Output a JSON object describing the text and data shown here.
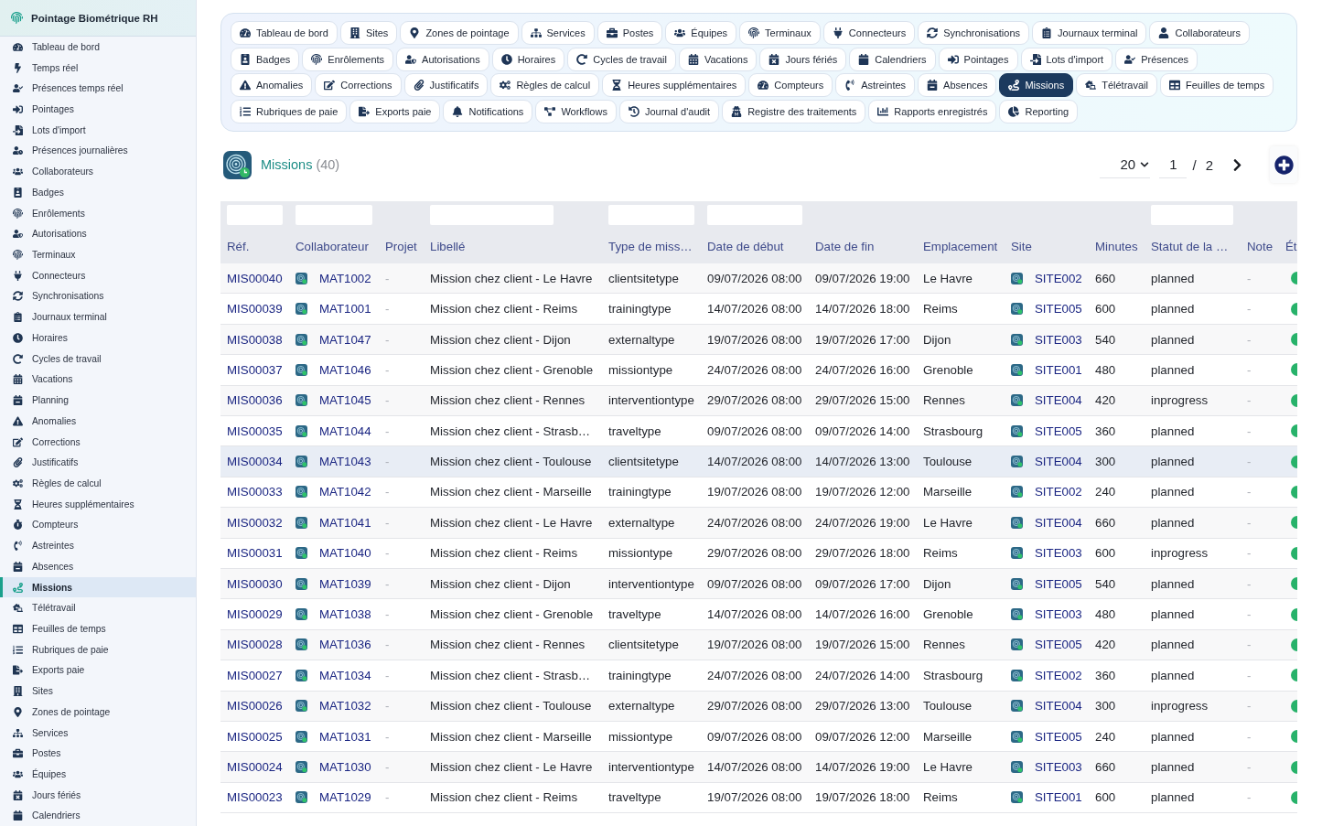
{
  "sidebar": {
    "title": "Pointage Biométrique RH",
    "items": [
      {
        "label": "Tableau de bord",
        "selected": false
      },
      {
        "label": "Temps réel",
        "selected": false
      },
      {
        "label": "Présences temps réel",
        "selected": false
      },
      {
        "label": "Pointages",
        "selected": false
      },
      {
        "label": "Lots d'import",
        "selected": false
      },
      {
        "label": "Présences journalières",
        "selected": false
      },
      {
        "label": "Collaborateurs",
        "selected": false
      },
      {
        "label": "Badges",
        "selected": false
      },
      {
        "label": "Enrôlements",
        "selected": false
      },
      {
        "label": "Autorisations",
        "selected": false
      },
      {
        "label": "Terminaux",
        "selected": false
      },
      {
        "label": "Connecteurs",
        "selected": false
      },
      {
        "label": "Synchronisations",
        "selected": false
      },
      {
        "label": "Journaux terminal",
        "selected": false
      },
      {
        "label": "Horaires",
        "selected": false
      },
      {
        "label": "Cycles de travail",
        "selected": false
      },
      {
        "label": "Vacations",
        "selected": false
      },
      {
        "label": "Planning",
        "selected": false
      },
      {
        "label": "Anomalies",
        "selected": false
      },
      {
        "label": "Corrections",
        "selected": false
      },
      {
        "label": "Justificatifs",
        "selected": false
      },
      {
        "label": "Règles de calcul",
        "selected": false
      },
      {
        "label": "Heures supplémentaires",
        "selected": false
      },
      {
        "label": "Compteurs",
        "selected": false
      },
      {
        "label": "Astreintes",
        "selected": false
      },
      {
        "label": "Absences",
        "selected": false
      },
      {
        "label": "Missions",
        "selected": true
      },
      {
        "label": "Télétravail",
        "selected": false
      },
      {
        "label": "Feuilles de temps",
        "selected": false
      },
      {
        "label": "Rubriques de paie",
        "selected": false
      },
      {
        "label": "Exports paie",
        "selected": false
      },
      {
        "label": "Sites",
        "selected": false
      },
      {
        "label": "Zones de pointage",
        "selected": false
      },
      {
        "label": "Services",
        "selected": false
      },
      {
        "label": "Postes",
        "selected": false
      },
      {
        "label": "Équipes",
        "selected": false
      },
      {
        "label": "Jours fériés",
        "selected": false
      },
      {
        "label": "Calendriers",
        "selected": false
      }
    ]
  },
  "nav_tabs": {
    "rows": [
      {
        "tabs": [
          {
            "label": "Tableau de bord",
            "selected": false
          },
          {
            "label": "Sites",
            "selected": false
          },
          {
            "label": "Zones de pointage",
            "selected": false
          },
          {
            "label": "Services",
            "selected": false
          },
          {
            "label": "Postes",
            "selected": false
          },
          {
            "label": "Équipes",
            "selected": false
          },
          {
            "label": "Terminaux",
            "selected": false
          },
          {
            "label": "Connecteurs",
            "selected": false
          },
          {
            "label": "Synchronisations",
            "selected": false
          },
          {
            "label": "Journaux terminal",
            "selected": false
          },
          {
            "label": "Collaborateurs",
            "selected": false
          }
        ]
      },
      {
        "tabs": [
          {
            "label": "Badges",
            "selected": false
          },
          {
            "label": "Enrôlements",
            "selected": false
          },
          {
            "label": "Autorisations",
            "selected": false
          },
          {
            "label": "Horaires",
            "selected": false
          },
          {
            "label": "Cycles de travail",
            "selected": false
          },
          {
            "label": "Vacations",
            "selected": false
          },
          {
            "label": "Jours fériés",
            "selected": false
          },
          {
            "label": "Calendriers",
            "selected": false
          },
          {
            "label": "Pointages",
            "selected": false
          },
          {
            "label": "Lots d'import",
            "selected": false
          },
          {
            "label": "Présences",
            "selected": false
          }
        ]
      },
      {
        "tabs": [
          {
            "label": "Anomalies",
            "selected": false
          },
          {
            "label": "Corrections",
            "selected": false
          },
          {
            "label": "Justificatifs",
            "selected": false
          },
          {
            "label": "Règles de calcul",
            "selected": false
          },
          {
            "label": "Heures supplémentaires",
            "selected": false
          },
          {
            "label": "Compteurs",
            "selected": false
          },
          {
            "label": "Astreintes",
            "selected": false
          },
          {
            "label": "Absences",
            "selected": false
          },
          {
            "label": "Missions",
            "selected": true
          },
          {
            "label": "Télétravail",
            "selected": false
          },
          {
            "label": "Feuilles de temps",
            "selected": false
          }
        ]
      },
      {
        "tabs": [
          {
            "label": "Rubriques de paie",
            "selected": false
          },
          {
            "label": "Exports paie",
            "selected": false
          },
          {
            "label": "Notifications",
            "selected": false
          },
          {
            "label": "Workflows",
            "selected": false
          },
          {
            "label": "Journal d'audit",
            "selected": false
          },
          {
            "label": "Registre des traitements",
            "selected": false
          },
          {
            "label": "Rapports enregistrés",
            "selected": false
          },
          {
            "label": "Reporting",
            "selected": false
          }
        ]
      }
    ]
  },
  "page_header": {
    "title": "Missions",
    "count": "(40)"
  },
  "pagination": {
    "page_size": "20",
    "page": "1",
    "separator": "/",
    "total_pages": "2"
  },
  "table": {
    "columns": [
      {
        "label": "Réf.",
        "filter": true
      },
      {
        "label": "Collaborateur",
        "filter": true
      },
      {
        "label": "Projet",
        "filter": false
      },
      {
        "label": "Libellé",
        "filter": true
      },
      {
        "label": "Type de miss…",
        "filter": true
      },
      {
        "label": "Date de début",
        "filter": true
      },
      {
        "label": "Date de fin",
        "filter": false
      },
      {
        "label": "Emplacement",
        "filter": false
      },
      {
        "label": "Site",
        "filter": false
      },
      {
        "label": "Minutes",
        "filter": false
      },
      {
        "label": "Statut de la …",
        "filter": true
      },
      {
        "label": "Note",
        "filter": false
      },
      {
        "label": "Ét",
        "filter": false
      }
    ],
    "rows": [
      {
        "ref": "MIS00040",
        "collaborator": "MAT1002",
        "project": "-",
        "label": "Mission chez client - Le Havre",
        "type": "clientsitetype",
        "start": "09/07/2026 08:00",
        "end": "09/07/2026 19:00",
        "location": "Le Havre",
        "site": "SITE002",
        "minutes": "660",
        "status": "planned",
        "note": "-",
        "active": true,
        "highlighted": false
      },
      {
        "ref": "MIS00039",
        "collaborator": "MAT1001",
        "project": "-",
        "label": "Mission chez client - Reims",
        "type": "trainingtype",
        "start": "14/07/2026 08:00",
        "end": "14/07/2026 18:00",
        "location": "Reims",
        "site": "SITE005",
        "minutes": "600",
        "status": "planned",
        "note": "-",
        "active": true,
        "highlighted": false
      },
      {
        "ref": "MIS00038",
        "collaborator": "MAT1047",
        "project": "-",
        "label": "Mission chez client - Dijon",
        "type": "externaltype",
        "start": "19/07/2026 08:00",
        "end": "19/07/2026 17:00",
        "location": "Dijon",
        "site": "SITE003",
        "minutes": "540",
        "status": "planned",
        "note": "-",
        "active": true,
        "highlighted": false
      },
      {
        "ref": "MIS00037",
        "collaborator": "MAT1046",
        "project": "-",
        "label": "Mission chez client - Grenoble",
        "type": "missiontype",
        "start": "24/07/2026 08:00",
        "end": "24/07/2026 16:00",
        "location": "Grenoble",
        "site": "SITE001",
        "minutes": "480",
        "status": "planned",
        "note": "-",
        "active": true,
        "highlighted": false
      },
      {
        "ref": "MIS00036",
        "collaborator": "MAT1045",
        "project": "-",
        "label": "Mission chez client - Rennes",
        "type": "interventiontype",
        "start": "29/07/2026 08:00",
        "end": "29/07/2026 15:00",
        "location": "Rennes",
        "site": "SITE004",
        "minutes": "420",
        "status": "inprogress",
        "note": "-",
        "active": true,
        "highlighted": false
      },
      {
        "ref": "MIS00035",
        "collaborator": "MAT1044",
        "project": "-",
        "label": "Mission chez client - Strasb…",
        "type": "traveltype",
        "start": "09/07/2026 08:00",
        "end": "09/07/2026 14:00",
        "location": "Strasbourg",
        "site": "SITE005",
        "minutes": "360",
        "status": "planned",
        "note": "-",
        "active": true,
        "highlighted": false
      },
      {
        "ref": "MIS00034",
        "collaborator": "MAT1043",
        "project": "-",
        "label": "Mission chez client - Toulouse",
        "type": "clientsitetype",
        "start": "14/07/2026 08:00",
        "end": "14/07/2026 13:00",
        "location": "Toulouse",
        "site": "SITE004",
        "minutes": "300",
        "status": "planned",
        "note": "-",
        "active": true,
        "highlighted": true
      },
      {
        "ref": "MIS00033",
        "collaborator": "MAT1042",
        "project": "-",
        "label": "Mission chez client - Marseille",
        "type": "trainingtype",
        "start": "19/07/2026 08:00",
        "end": "19/07/2026 12:00",
        "location": "Marseille",
        "site": "SITE002",
        "minutes": "240",
        "status": "planned",
        "note": "-",
        "active": true,
        "highlighted": false
      },
      {
        "ref": "MIS00032",
        "collaborator": "MAT1041",
        "project": "-",
        "label": "Mission chez client - Le Havre",
        "type": "externaltype",
        "start": "24/07/2026 08:00",
        "end": "24/07/2026 19:00",
        "location": "Le Havre",
        "site": "SITE004",
        "minutes": "660",
        "status": "planned",
        "note": "-",
        "active": true,
        "highlighted": false
      },
      {
        "ref": "MIS00031",
        "collaborator": "MAT1040",
        "project": "-",
        "label": "Mission chez client - Reims",
        "type": "missiontype",
        "start": "29/07/2026 08:00",
        "end": "29/07/2026 18:00",
        "location": "Reims",
        "site": "SITE003",
        "minutes": "600",
        "status": "inprogress",
        "note": "-",
        "active": true,
        "highlighted": false
      },
      {
        "ref": "MIS00030",
        "collaborator": "MAT1039",
        "project": "-",
        "label": "Mission chez client - Dijon",
        "type": "interventiontype",
        "start": "09/07/2026 08:00",
        "end": "09/07/2026 17:00",
        "location": "Dijon",
        "site": "SITE005",
        "minutes": "540",
        "status": "planned",
        "note": "-",
        "active": true,
        "highlighted": false
      },
      {
        "ref": "MIS00029",
        "collaborator": "MAT1038",
        "project": "-",
        "label": "Mission chez client - Grenoble",
        "type": "traveltype",
        "start": "14/07/2026 08:00",
        "end": "14/07/2026 16:00",
        "location": "Grenoble",
        "site": "SITE003",
        "minutes": "480",
        "status": "planned",
        "note": "-",
        "active": true,
        "highlighted": false
      },
      {
        "ref": "MIS00028",
        "collaborator": "MAT1036",
        "project": "-",
        "label": "Mission chez client - Rennes",
        "type": "clientsitetype",
        "start": "19/07/2026 08:00",
        "end": "19/07/2026 15:00",
        "location": "Rennes",
        "site": "SITE005",
        "minutes": "420",
        "status": "planned",
        "note": "-",
        "active": true,
        "highlighted": false
      },
      {
        "ref": "MIS00027",
        "collaborator": "MAT1034",
        "project": "-",
        "label": "Mission chez client - Strasb…",
        "type": "trainingtype",
        "start": "24/07/2026 08:00",
        "end": "24/07/2026 14:00",
        "location": "Strasbourg",
        "site": "SITE002",
        "minutes": "360",
        "status": "planned",
        "note": "-",
        "active": true,
        "highlighted": false
      },
      {
        "ref": "MIS00026",
        "collaborator": "MAT1032",
        "project": "-",
        "label": "Mission chez client - Toulouse",
        "type": "externaltype",
        "start": "29/07/2026 08:00",
        "end": "29/07/2026 13:00",
        "location": "Toulouse",
        "site": "SITE004",
        "minutes": "300",
        "status": "inprogress",
        "note": "-",
        "active": true,
        "highlighted": false
      },
      {
        "ref": "MIS00025",
        "collaborator": "MAT1031",
        "project": "-",
        "label": "Mission chez client - Marseille",
        "type": "missiontype",
        "start": "09/07/2026 08:00",
        "end": "09/07/2026 12:00",
        "location": "Marseille",
        "site": "SITE005",
        "minutes": "240",
        "status": "planned",
        "note": "-",
        "active": true,
        "highlighted": false
      },
      {
        "ref": "MIS00024",
        "collaborator": "MAT1030",
        "project": "-",
        "label": "Mission chez client - Le Havre",
        "type": "interventiontype",
        "start": "14/07/2026 08:00",
        "end": "14/07/2026 19:00",
        "location": "Le Havre",
        "site": "SITE003",
        "minutes": "660",
        "status": "planned",
        "note": "-",
        "active": true,
        "highlighted": false
      },
      {
        "ref": "MIS00023",
        "collaborator": "MAT1029",
        "project": "-",
        "label": "Mission chez client - Reims",
        "type": "traveltype",
        "start": "19/07/2026 08:00",
        "end": "19/07/2026 18:00",
        "location": "Reims",
        "site": "SITE001",
        "minutes": "600",
        "status": "planned",
        "note": "-",
        "active": true,
        "highlighted": false
      }
    ]
  }
}
